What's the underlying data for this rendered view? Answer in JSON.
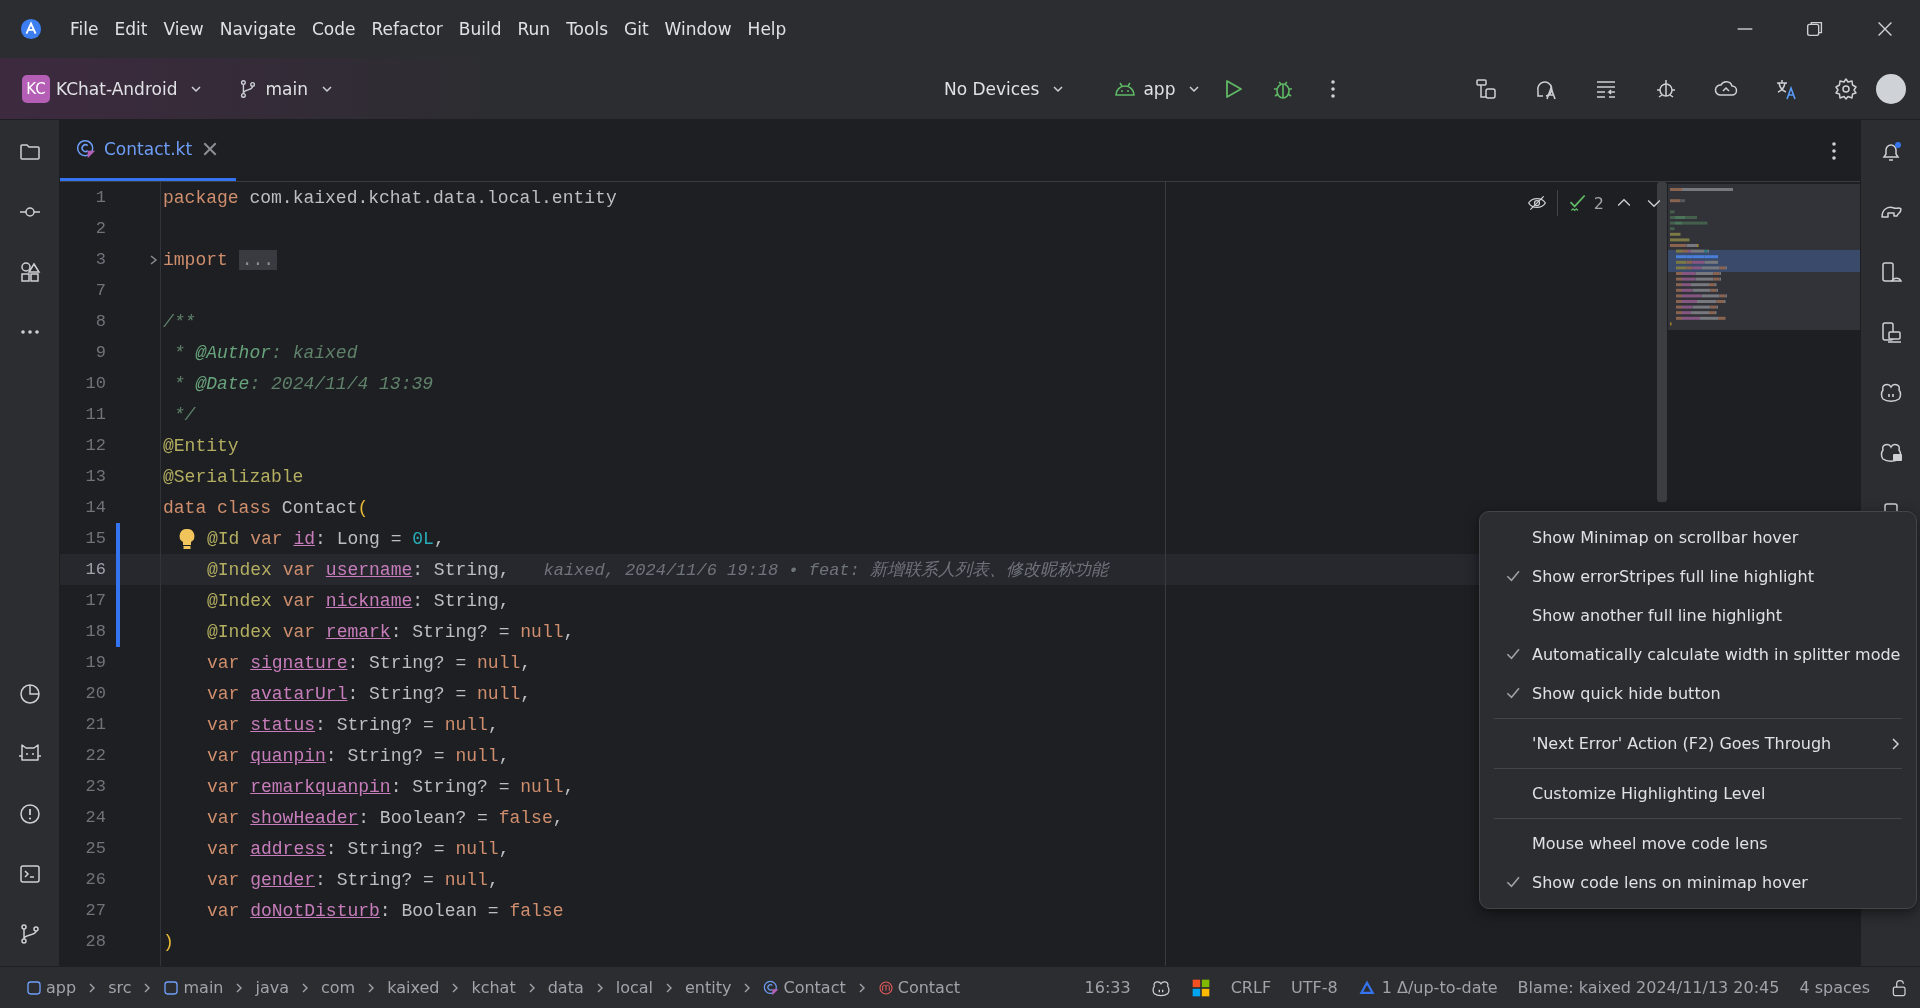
{
  "menu_bar": {
    "items": [
      "File",
      "Edit",
      "View",
      "Navigate",
      "Code",
      "Refactor",
      "Build",
      "Run",
      "Tools",
      "Git",
      "Window",
      "Help"
    ]
  },
  "toolbar": {
    "project_badge": "KC",
    "project": "KChat-Android",
    "branch": "main",
    "device": "No Devices",
    "run_config": "app"
  },
  "tabs": [
    {
      "label": "Contact.kt",
      "selected": true
    }
  ],
  "editor": {
    "problems_count": "2",
    "lines": [
      {
        "number": "1",
        "changed": false,
        "current": false,
        "indented": false,
        "tokens": [
          {
            "kind": "kw",
            "text": "package "
          },
          {
            "kind": "plain",
            "text": "com.kaixed.kchat.data.local.entity"
          }
        ]
      },
      {
        "number": "2",
        "changed": false,
        "current": false,
        "indented": false
      },
      {
        "number": "3",
        "changed": false,
        "current": false,
        "indented": false,
        "kind": "fold",
        "tokens": [
          {
            "kind": "kw",
            "text": "import "
          },
          {
            "kind": "fold",
            "text": "..."
          }
        ]
      },
      {
        "number": "7",
        "changed": false,
        "current": false,
        "indented": false
      },
      {
        "number": "8",
        "changed": false,
        "current": false,
        "indented": false,
        "tokens": [
          {
            "kind": "doc",
            "text": "/**"
          }
        ]
      },
      {
        "number": "9",
        "changed": false,
        "current": false,
        "indented": false,
        "tokens": [
          {
            "kind": "doc",
            "text": " * "
          },
          {
            "kind": "doctag",
            "text": "@Author"
          },
          {
            "kind": "doc",
            "text": ": kaixed"
          }
        ]
      },
      {
        "number": "10",
        "changed": false,
        "current": false,
        "indented": false,
        "tokens": [
          {
            "kind": "doc",
            "text": " * "
          },
          {
            "kind": "doctag",
            "text": "@Date"
          },
          {
            "kind": "doc",
            "text": ": 2024/11/4 13:39"
          }
        ]
      },
      {
        "number": "11",
        "changed": false,
        "current": false,
        "indented": false,
        "tokens": [
          {
            "kind": "doc",
            "text": " */"
          }
        ]
      },
      {
        "number": "12",
        "changed": false,
        "current": false,
        "indented": false,
        "tokens": [
          {
            "kind": "ann",
            "text": "@Entity"
          }
        ]
      },
      {
        "number": "13",
        "changed": false,
        "current": false,
        "indented": false,
        "tokens": [
          {
            "kind": "ann",
            "text": "@Serializable"
          }
        ]
      },
      {
        "number": "14",
        "changed": false,
        "current": false,
        "indented": false,
        "tokens": [
          {
            "kind": "kw",
            "text": "data class "
          },
          {
            "kind": "plain",
            "text": "Contact"
          },
          {
            "kind": "bracket",
            "text": "("
          }
        ]
      },
      {
        "number": "15",
        "changed": true,
        "current": false,
        "indented": true,
        "kind": "bulb",
        "tokens": [
          {
            "kind": "ann",
            "text": "@Id "
          },
          {
            "kind": "kw",
            "text": "var "
          },
          {
            "kind": "field",
            "text": "id"
          },
          {
            "kind": "plain",
            "text": ": Long = "
          },
          {
            "kind": "num",
            "text": "0L"
          },
          {
            "kind": "plain",
            "text": ","
          }
        ]
      },
      {
        "number": "16",
        "changed": true,
        "current": true,
        "indented": true,
        "tokens": [
          {
            "kind": "ann",
            "text": "@Index "
          },
          {
            "kind": "kw",
            "text": "var "
          },
          {
            "kind": "field",
            "text": "username"
          },
          {
            "kind": "plain",
            "text": ": String,"
          }
        ],
        "blame": "kaixed, 2024/11/6 19:18 • feat: 新增联系人列表、修改昵称功能"
      },
      {
        "number": "17",
        "changed": true,
        "current": false,
        "indented": true,
        "tokens": [
          {
            "kind": "ann",
            "text": "@Index "
          },
          {
            "kind": "kw",
            "text": "var "
          },
          {
            "kind": "field",
            "text": "nickname"
          },
          {
            "kind": "plain",
            "text": ": String,"
          }
        ]
      },
      {
        "number": "18",
        "changed": true,
        "current": false,
        "indented": true,
        "tokens": [
          {
            "kind": "ann",
            "text": "@Index "
          },
          {
            "kind": "kw",
            "text": "var "
          },
          {
            "kind": "field",
            "text": "remark"
          },
          {
            "kind": "plain",
            "text": ": String? = "
          },
          {
            "kind": "kw",
            "text": "null"
          },
          {
            "kind": "plain",
            "text": ","
          }
        ]
      },
      {
        "number": "19",
        "changed": false,
        "current": false,
        "indented": true,
        "tokens": [
          {
            "kind": "kw",
            "text": "var "
          },
          {
            "kind": "field",
            "text": "signature"
          },
          {
            "kind": "plain",
            "text": ": String? = "
          },
          {
            "kind": "kw",
            "text": "null"
          },
          {
            "kind": "plain",
            "text": ","
          }
        ]
      },
      {
        "number": "20",
        "changed": false,
        "current": false,
        "indented": true,
        "tokens": [
          {
            "kind": "kw",
            "text": "var "
          },
          {
            "kind": "field",
            "text": "avatarUrl"
          },
          {
            "kind": "plain",
            "text": ": String? = "
          },
          {
            "kind": "kw",
            "text": "null"
          },
          {
            "kind": "plain",
            "text": ","
          }
        ]
      },
      {
        "number": "21",
        "changed": false,
        "current": false,
        "indented": true,
        "tokens": [
          {
            "kind": "kw",
            "text": "var "
          },
          {
            "kind": "field",
            "text": "status"
          },
          {
            "kind": "plain",
            "text": ": String? = "
          },
          {
            "kind": "kw",
            "text": "null"
          },
          {
            "kind": "plain",
            "text": ","
          }
        ]
      },
      {
        "number": "22",
        "changed": false,
        "current": false,
        "indented": true,
        "tokens": [
          {
            "kind": "kw",
            "text": "var "
          },
          {
            "kind": "field",
            "text": "quanpin"
          },
          {
            "kind": "plain",
            "text": ": String? = "
          },
          {
            "kind": "kw",
            "text": "null"
          },
          {
            "kind": "plain",
            "text": ","
          }
        ]
      },
      {
        "number": "23",
        "changed": false,
        "current": false,
        "indented": true,
        "tokens": [
          {
            "kind": "kw",
            "text": "var "
          },
          {
            "kind": "field",
            "text": "remarkquanpin"
          },
          {
            "kind": "plain",
            "text": ": String? = "
          },
          {
            "kind": "kw",
            "text": "null"
          },
          {
            "kind": "plain",
            "text": ","
          }
        ]
      },
      {
        "number": "24",
        "changed": false,
        "current": false,
        "indented": true,
        "tokens": [
          {
            "kind": "kw",
            "text": "var "
          },
          {
            "kind": "field",
            "text": "showHeader"
          },
          {
            "kind": "plain",
            "text": ": Boolean? = "
          },
          {
            "kind": "kw",
            "text": "false"
          },
          {
            "kind": "plain",
            "text": ","
          }
        ]
      },
      {
        "number": "25",
        "changed": false,
        "current": false,
        "indented": true,
        "tokens": [
          {
            "kind": "kw",
            "text": "var "
          },
          {
            "kind": "field",
            "text": "address"
          },
          {
            "kind": "plain",
            "text": ": String? = "
          },
          {
            "kind": "kw",
            "text": "null"
          },
          {
            "kind": "plain",
            "text": ","
          }
        ]
      },
      {
        "number": "26",
        "changed": false,
        "current": false,
        "indented": true,
        "tokens": [
          {
            "kind": "kw",
            "text": "var "
          },
          {
            "kind": "field",
            "text": "gender"
          },
          {
            "kind": "plain",
            "text": ": String? = "
          },
          {
            "kind": "kw",
            "text": "null"
          },
          {
            "kind": "plain",
            "text": ","
          }
        ]
      },
      {
        "number": "27",
        "changed": false,
        "current": false,
        "indented": true,
        "tokens": [
          {
            "kind": "kw",
            "text": "var "
          },
          {
            "kind": "field",
            "text": "doNotDisturb"
          },
          {
            "kind": "plain",
            "text": ": Boolean = "
          },
          {
            "kind": "kw",
            "text": "false"
          }
        ]
      },
      {
        "number": "28",
        "changed": false,
        "current": false,
        "indented": false,
        "tokens": [
          {
            "kind": "bracket",
            "text": ")"
          }
        ]
      }
    ]
  },
  "context_menu": {
    "groups": [
      [
        {
          "label": "Show Minimap on scrollbar hover",
          "kind": "toggle",
          "checked": false
        },
        {
          "label": "Show errorStripes full line highlight",
          "kind": "toggle",
          "checked": true
        },
        {
          "label": "Show another full line highlight",
          "kind": "toggle",
          "checked": false
        },
        {
          "label": "Automatically calculate width in splitter mode",
          "kind": "toggle",
          "checked": true
        },
        {
          "label": "Show quick hide button",
          "kind": "toggle",
          "checked": true
        }
      ],
      [
        {
          "label": "'Next Error' Action (F2) Goes Through",
          "kind": "submenu",
          "checked": false
        }
      ],
      [
        {
          "label": "Customize Highlighting Level",
          "kind": "action",
          "checked": false
        }
      ],
      [
        {
          "label": "Mouse wheel move code lens",
          "kind": "toggle",
          "checked": false
        },
        {
          "label": "Show code lens on minimap hover",
          "kind": "toggle",
          "checked": true
        }
      ]
    ]
  },
  "status_bar": {
    "breadcrumbs": [
      {
        "label": "app",
        "kind": "module"
      },
      {
        "label": "src",
        "kind": "folder"
      },
      {
        "label": "main",
        "kind": "module"
      },
      {
        "label": "java",
        "kind": "folder"
      },
      {
        "label": "com",
        "kind": "folder"
      },
      {
        "label": "kaixed",
        "kind": "folder"
      },
      {
        "label": "kchat",
        "kind": "folder"
      },
      {
        "label": "data",
        "kind": "folder"
      },
      {
        "label": "local",
        "kind": "folder"
      },
      {
        "label": "entity",
        "kind": "folder"
      },
      {
        "label": "Contact",
        "kind": "class"
      },
      {
        "label": "Contact",
        "kind": "method"
      }
    ],
    "position": "16:33",
    "line_separator": "CRLF",
    "encoding": "UTF-8",
    "vcs_status": "1 Δ/up-to-date",
    "blame": "Blame: kaixed 2024/11/13 20:45",
    "indent": "4 spaces"
  }
}
